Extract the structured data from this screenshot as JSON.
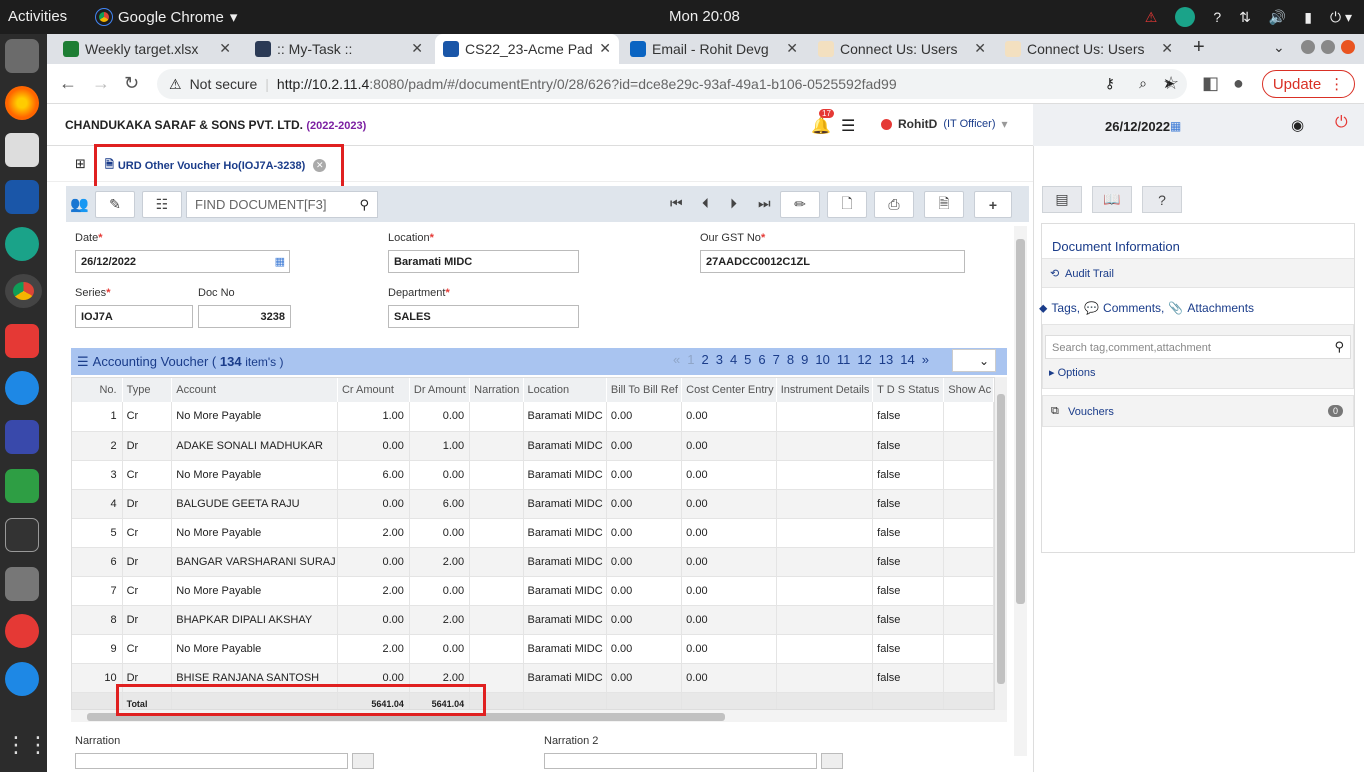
{
  "os": {
    "activities": "Activities",
    "app_name": "Google Chrome",
    "clock": "Mon 20:08"
  },
  "browser": {
    "tabs": [
      {
        "label": "Weekly target.xlsx",
        "color": "#1e7e34"
      },
      {
        "label": ":: My-Task ::",
        "color": "#2b3a55"
      },
      {
        "label": "CS22_23-Acme Pad",
        "color": "#1a56a8"
      },
      {
        "label": "Email - Rohit Devg",
        "color": "#0a64c2"
      },
      {
        "label": "Connect Us: Users",
        "color": "#c0392b"
      },
      {
        "label": "Connect Us: Users",
        "color": "#c0392b"
      }
    ],
    "not_secure": "Not secure",
    "url_host": "http://10.2.11.4",
    "url_rest": ":8080/padm/#/documentEntry/0/28/626?id=dce8e29c-93af-49a1-b106-0525592fad99",
    "update_label": "Update"
  },
  "header": {
    "company": "CHANDUKAKA SARAF & SONS PVT. LTD.",
    "year": "(2022-2023)",
    "notif_count": "17",
    "user": "RohitD",
    "role": "(IT Officer)",
    "date": "26/12/2022"
  },
  "doc_tab": {
    "title": "URD Other Voucher Ho(IOJ7A-3238)"
  },
  "toolbar": {
    "find_placeholder": "FIND DOCUMENT[F3]"
  },
  "form": {
    "date_label": "Date",
    "date_value": "26/12/2022",
    "location_label": "Location",
    "location_value": "Baramati MIDC",
    "gst_label": "Our GST No",
    "gst_value": "27AADCC0012C1ZL",
    "series_label": "Series",
    "series_value": "IOJ7A",
    "docno_label": "Doc No",
    "docno_value": "3238",
    "dept_label": "Department",
    "dept_value": "SALES",
    "narration_label": "Narration",
    "narration2_label": "Narration 2"
  },
  "voucher": {
    "title": "Accounting Voucher (",
    "count": "134",
    "items_label": "item's )",
    "pages": [
      "«",
      "1",
      "2",
      "3",
      "4",
      "5",
      "6",
      "7",
      "8",
      "9",
      "10",
      "11",
      "12",
      "13",
      "14",
      "»"
    ],
    "columns": [
      "No.",
      "Type",
      "Account",
      "Cr Amount",
      "Dr Amount",
      "Narration",
      "Location",
      "Bill To Bill Ref",
      "Cost Center Entry",
      "Instrument Details",
      "T D S Status",
      "Show Ac"
    ],
    "rows": [
      [
        "1",
        "Cr",
        "No More Payable",
        "1.00",
        "0.00",
        "",
        "Baramati MIDC",
        "0.00",
        "0.00",
        "",
        "false"
      ],
      [
        "2",
        "Dr",
        "ADAKE SONALI MADHUKAR",
        "0.00",
        "1.00",
        "",
        "Baramati MIDC",
        "0.00",
        "0.00",
        "",
        "false"
      ],
      [
        "3",
        "Cr",
        "No More Payable",
        "6.00",
        "0.00",
        "",
        "Baramati MIDC",
        "0.00",
        "0.00",
        "",
        "false"
      ],
      [
        "4",
        "Dr",
        "BALGUDE GEETA RAJU",
        "0.00",
        "6.00",
        "",
        "Baramati MIDC",
        "0.00",
        "0.00",
        "",
        "false"
      ],
      [
        "5",
        "Cr",
        "No More Payable",
        "2.00",
        "0.00",
        "",
        "Baramati MIDC",
        "0.00",
        "0.00",
        "",
        "false"
      ],
      [
        "6",
        "Dr",
        "BANGAR VARSHARANI SURAJ",
        "0.00",
        "2.00",
        "",
        "Baramati MIDC",
        "0.00",
        "0.00",
        "",
        "false"
      ],
      [
        "7",
        "Cr",
        "No More Payable",
        "2.00",
        "0.00",
        "",
        "Baramati MIDC",
        "0.00",
        "0.00",
        "",
        "false"
      ],
      [
        "8",
        "Dr",
        "BHAPKAR DIPALI AKSHAY",
        "0.00",
        "2.00",
        "",
        "Baramati MIDC",
        "0.00",
        "0.00",
        "",
        "false"
      ],
      [
        "9",
        "Cr",
        "No More Payable",
        "2.00",
        "0.00",
        "",
        "Baramati MIDC",
        "0.00",
        "0.00",
        "",
        "false"
      ],
      [
        "10",
        "Dr",
        "BHISE RANJANA SANTOSH",
        "0.00",
        "2.00",
        "",
        "Baramati MIDC",
        "0.00",
        "0.00",
        "",
        "false"
      ]
    ],
    "total_label": "Total",
    "total_cr": "5641.04",
    "total_dr": "5641.04"
  },
  "right_panel": {
    "doc_info": "Document Information",
    "audit_trail": "Audit Trail",
    "tags": "Tags,",
    "comments": "Comments,",
    "attachments": "Attachments",
    "search_placeholder": "Search tag,comment,attachment",
    "options": "Options",
    "vouchers": "Vouchers",
    "vouchers_count": "0"
  }
}
